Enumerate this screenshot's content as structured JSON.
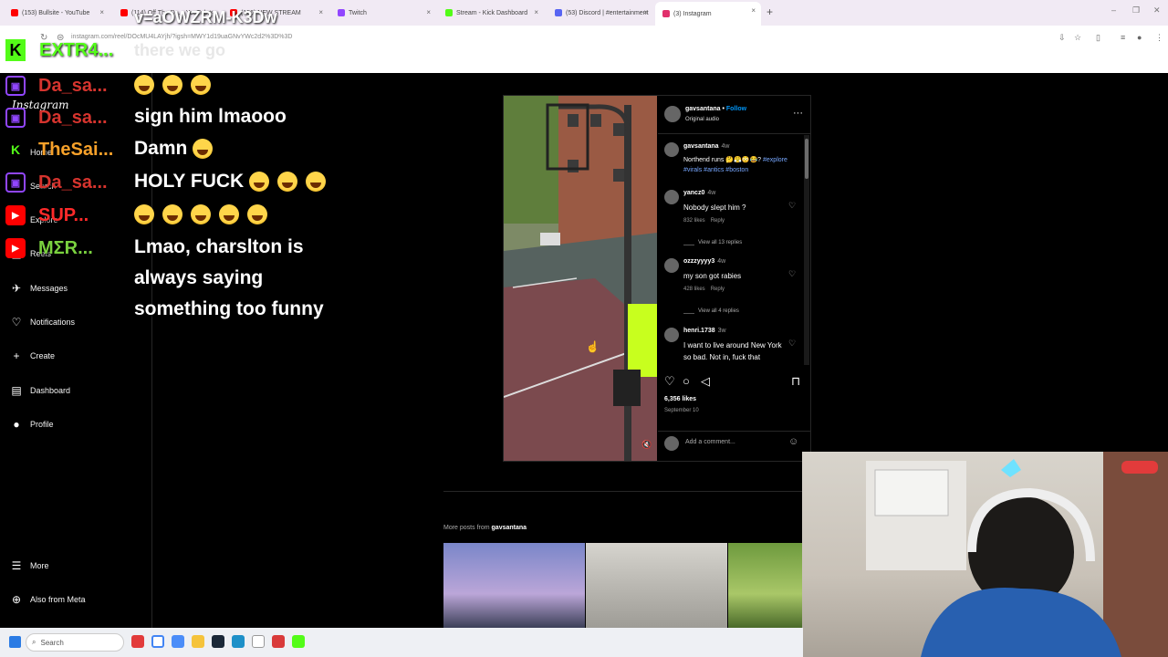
{
  "browser": {
    "tabs": [
      {
        "label": "(153) Bullsite - YouTube",
        "color": "#ff0000"
      },
      {
        "label": "(114) Off The D... - YouTube",
        "color": "#ff0000"
      },
      {
        "label": "(156) NEW STREAM",
        "color": "#ff0000"
      },
      {
        "label": "Twitch",
        "color": "#9146ff"
      },
      {
        "label": "Stream - Kick Dashboard",
        "color": "#53fc18"
      },
      {
        "label": "(53) Discord | #entertainment",
        "color": "#5865f2"
      },
      {
        "label": "(3) Instagram",
        "color": "#e1306c"
      }
    ],
    "url": "instagram.com/reel/DOcMU4LAYjh/?igsh=MWY1d19uaGNvYWc2d2%3D%3D",
    "new_tab": "+",
    "win_controls": [
      "–",
      "❐",
      "✕"
    ]
  },
  "overlay": {
    "code": "v=aOWZRM-K3Dw",
    "subtitle": "there we go",
    "top_user": "EXTR4..."
  },
  "chat": [
    {
      "platform": "twitch",
      "user": "Da_sa...",
      "user_color": "#d6342e",
      "message": "",
      "emoji_count": 3
    },
    {
      "platform": "twitch",
      "user": "Da_sa...",
      "user_color": "#d6342e",
      "message": "sign him lmaooo",
      "emoji_count": 0
    },
    {
      "platform": "kick",
      "user": "TheSai...",
      "user_color": "#f7a12a",
      "message": "Damn",
      "emoji_count": 1
    },
    {
      "platform": "twitch",
      "user": "Da_sa...",
      "user_color": "#d6342e",
      "message": "HOLY FUCK",
      "emoji_count": 3
    },
    {
      "platform": "youtube",
      "user": "SUP...",
      "user_color": "#ff2a2a",
      "message": "",
      "emoji_count": 5
    },
    {
      "platform": "youtube",
      "user": "MΣR...",
      "user_color": "#7ad13f",
      "message": "Lmao, charslton is",
      "emoji_count": 0
    }
  ],
  "chat_continued": [
    "always saying",
    "something too funny"
  ],
  "instagram": {
    "logo": "Instagram",
    "nav": [
      {
        "label": "Home",
        "icon": "home-icon",
        "glyph": "⌂"
      },
      {
        "label": "Search",
        "icon": "search-icon",
        "glyph": "⌕"
      },
      {
        "label": "Explore",
        "icon": "compass-icon",
        "glyph": "◎"
      },
      {
        "label": "Reels",
        "icon": "reels-icon",
        "glyph": "▣"
      },
      {
        "label": "Messages",
        "icon": "messages-icon",
        "glyph": "✈"
      },
      {
        "label": "Notifications",
        "icon": "heart-icon",
        "glyph": "♡"
      },
      {
        "label": "Create",
        "icon": "plus-icon",
        "glyph": "+"
      },
      {
        "label": "Dashboard",
        "icon": "dashboard-icon",
        "glyph": "▤"
      },
      {
        "label": "Profile",
        "icon": "avatar-icon",
        "glyph": "●"
      }
    ],
    "bottom_nav": [
      {
        "label": "More",
        "icon": "menu-icon",
        "glyph": "☰"
      },
      {
        "label": "Also from Meta",
        "icon": "meta-icon",
        "glyph": "⊕"
      }
    ]
  },
  "post": {
    "username": "gavsantana",
    "follow": "Follow",
    "audio": "Original audio",
    "caption_user": "gavsantana",
    "caption_time": "4w",
    "caption_text": "Northend runs 🤔😤😳😂?",
    "caption_tags": "#explore #virals #antics #boston",
    "comments": [
      {
        "user": "yancz0",
        "time": "4w",
        "text": "Nobody slept him ?",
        "likes": "832 likes",
        "reply": "Reply",
        "view_all": "View all 13 replies"
      },
      {
        "user": "ozzzyyyy3",
        "time": "4w",
        "text": "my son got rabies",
        "likes": "428 likes",
        "reply": "Reply",
        "view_all": "View all 4 replies"
      },
      {
        "user": "henri.1738",
        "time": "3w",
        "text": "I want to live around New York so bad. Not in, fuck that",
        "likes": "",
        "reply": "",
        "view_all": ""
      }
    ],
    "likes": "6,356 likes",
    "date": "September 10",
    "add_comment_placeholder": "Add a comment..."
  },
  "more_posts": {
    "prefix": "More posts from",
    "user": "gavsantana"
  },
  "taskbar": {
    "search": "Search"
  }
}
